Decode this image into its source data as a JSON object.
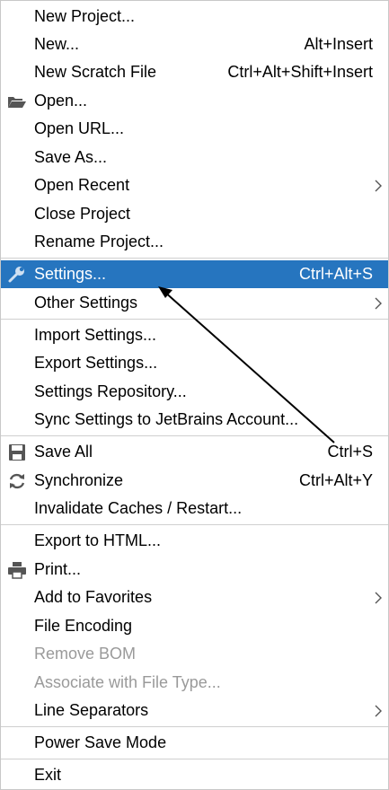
{
  "menu": {
    "items": [
      {
        "label": "New Project..."
      },
      {
        "label": "New...",
        "shortcut": "Alt+Insert"
      },
      {
        "label": "New Scratch File",
        "shortcut": "Ctrl+Alt+Shift+Insert"
      },
      {
        "label": "Open...",
        "icon": "folder-open-icon"
      },
      {
        "label": "Open URL..."
      },
      {
        "label": "Save As..."
      },
      {
        "label": "Open Recent",
        "submenu": true
      },
      {
        "label": "Close Project"
      },
      {
        "label": "Rename Project..."
      },
      {
        "label": "Settings...",
        "shortcut": "Ctrl+Alt+S",
        "icon": "wrench-icon",
        "selected": true
      },
      {
        "label": "Other Settings",
        "submenu": true
      },
      {
        "label": "Import Settings..."
      },
      {
        "label": "Export Settings..."
      },
      {
        "label": "Settings Repository..."
      },
      {
        "label": "Sync Settings to JetBrains Account..."
      },
      {
        "label": "Save All",
        "shortcut": "Ctrl+S",
        "icon": "save-icon"
      },
      {
        "label": "Synchronize",
        "shortcut": "Ctrl+Alt+Y",
        "icon": "sync-icon"
      },
      {
        "label": "Invalidate Caches / Restart..."
      },
      {
        "label": "Export to HTML..."
      },
      {
        "label": "Print...",
        "icon": "printer-icon"
      },
      {
        "label": "Add to Favorites",
        "submenu": true
      },
      {
        "label": "File Encoding"
      },
      {
        "label": "Remove BOM",
        "disabled": true
      },
      {
        "label": "Associate with File Type...",
        "disabled": true
      },
      {
        "label": "Line Separators",
        "submenu": true
      },
      {
        "label": "Power Save Mode"
      },
      {
        "label": "Exit"
      }
    ]
  },
  "colors": {
    "selected_bg": "#2675bf",
    "disabled_text": "#9a9a9a",
    "annotation_arrow": "#000000"
  }
}
